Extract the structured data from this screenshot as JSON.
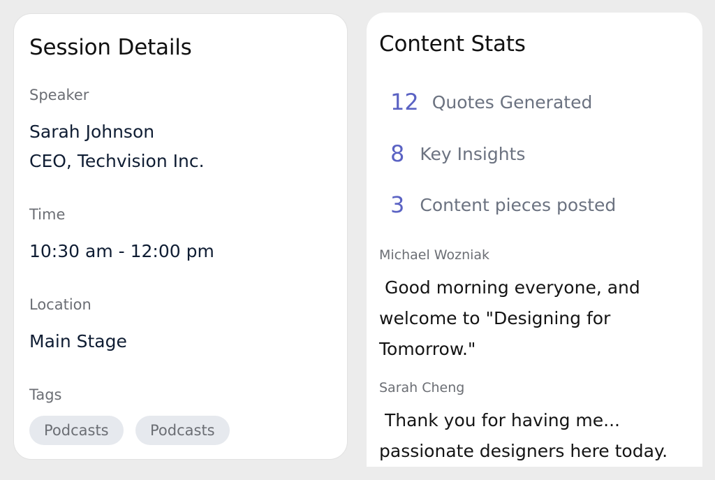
{
  "session": {
    "title": "Session Details",
    "speaker_label": "Speaker",
    "speaker_name": "Sarah Johnson",
    "speaker_role": "CEO, Techvision Inc.",
    "time_label": "Time",
    "time_value": "10:30 am - 12:00 pm",
    "location_label": "Location",
    "location_value": "Main Stage",
    "tags_label": "Tags",
    "tags": [
      "Podcasts",
      "Podcasts"
    ]
  },
  "stats": {
    "title": "Content Stats",
    "items": [
      {
        "count": "12",
        "label": "Quotes  Generated"
      },
      {
        "count": "8",
        "label": "Key Insights"
      },
      {
        "count": "3",
        "label": "Content pieces posted"
      }
    ]
  },
  "transcript": [
    {
      "author": "Michael Wozniak",
      "text": " Good morning everyone, and welcome to \"Designing for Tomorrow.\""
    },
    {
      "author": "Sarah Cheng",
      "text": " Thank you for having me... passionate designers here today."
    }
  ],
  "colors": {
    "background": "#ececec",
    "card": "#ffffff",
    "accent_number": "#5a62c3",
    "tag_bg": "#e6e9ee"
  }
}
